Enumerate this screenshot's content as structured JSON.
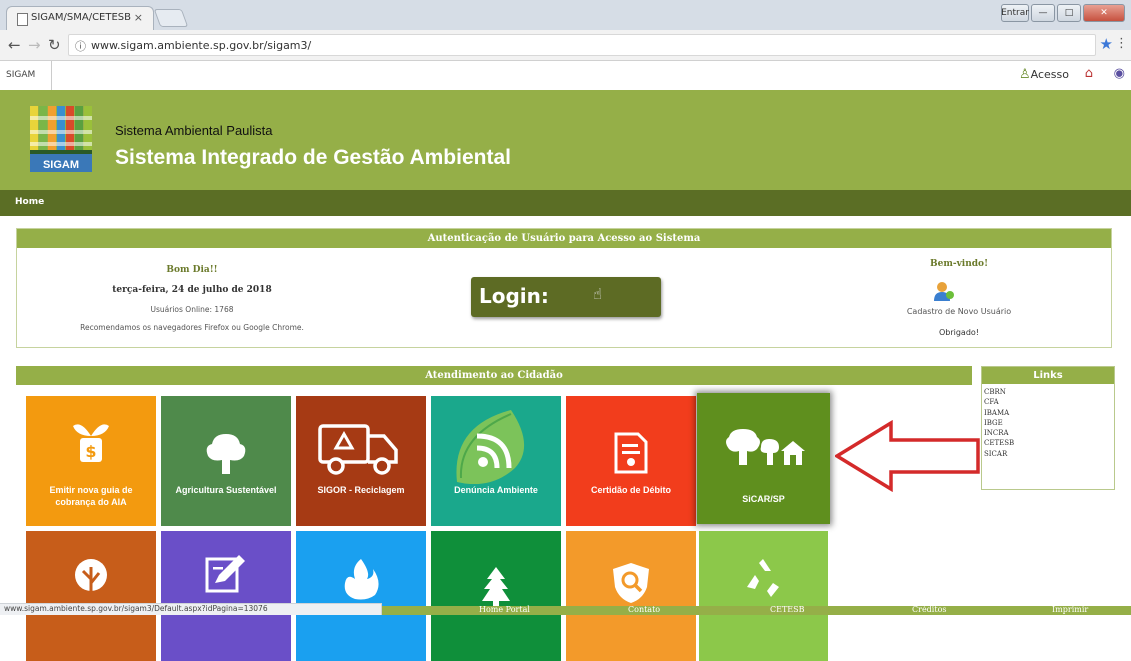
{
  "browser": {
    "tab_title": "SIGAM/SMA/CETESB",
    "tab_close": "×",
    "url": "www.sigam.ambiente.sp.gov.br/sigam3/",
    "window_controls": [
      "Entrar",
      "—",
      "□",
      "✕"
    ]
  },
  "site_bar": {
    "name": "SIGAM",
    "acesso_label": "Acesso"
  },
  "header": {
    "subtitle": "Sistema Ambiental Paulista",
    "title": "Sistema Integrado de Gestão Ambiental",
    "logo_text": "SIGAM"
  },
  "nav": {
    "home": "Home"
  },
  "auth": {
    "header": "Autenticação de Usuário para Acesso ao Sistema",
    "greeting": "Bom Dia!!",
    "date": "terça-feira, 24 de julho de 2018",
    "online": "Usuários Online: 1768",
    "recommend": "Recomendamos os navegadores Firefox ou Google Chrome.",
    "login_label": "Login:",
    "welcome": "Bem-vindo!",
    "new_user": "Cadastro de Novo Usuário",
    "thanks": "Obrigado!"
  },
  "citizen": {
    "header": "Atendimento ao Cidadão"
  },
  "links": {
    "header": "Links",
    "items": [
      "CBRN",
      "CFA",
      "IBAMA",
      "IBGE",
      "INCRA",
      "CETESB",
      "SICAR"
    ]
  },
  "tiles": [
    {
      "label": "Emitir nova guia de cobrança do AIA",
      "color": "#f39a0f",
      "icon": "money-plant-icon"
    },
    {
      "label": "Agricultura Sustentável",
      "color": "#4f8a4b",
      "icon": "tree-icon"
    },
    {
      "label": "SIGOR - Reciclagem",
      "color": "#a63a14",
      "icon": "recycling-truck-icon"
    },
    {
      "label": "Denúncia Ambiente",
      "color": "#1aa88c",
      "icon": "rss-leaf-icon"
    },
    {
      "label": "Certidão de Débito",
      "color": "#f23d1c",
      "icon": "certificate-icon"
    },
    {
      "label": "SiCAR/SP",
      "color": "#5f8f1e",
      "icon": "trees-house-icon"
    },
    {
      "label": "",
      "color": "#c75d1a",
      "icon": "forest-tree-icon"
    },
    {
      "label": "",
      "color": "#6a4fc8",
      "icon": "edit-document-icon"
    },
    {
      "label": "",
      "color": "#1aa0f0",
      "icon": "fire-icon"
    },
    {
      "label": "",
      "color": "#0f8f3a",
      "icon": "pine-tree-icon"
    },
    {
      "label": "",
      "color": "#f39a2a",
      "icon": "search-shield-icon"
    },
    {
      "label": "",
      "color": "#8cc84a",
      "icon": "recycle-icon"
    }
  ],
  "footer": {
    "status_url": "www.sigam.ambiente.sp.gov.br/sigam3/Default.aspx?idPagina=13076",
    "links": [
      "Home Portal",
      "Contato",
      "CETESB",
      "Créditos",
      "Imprimir"
    ]
  }
}
